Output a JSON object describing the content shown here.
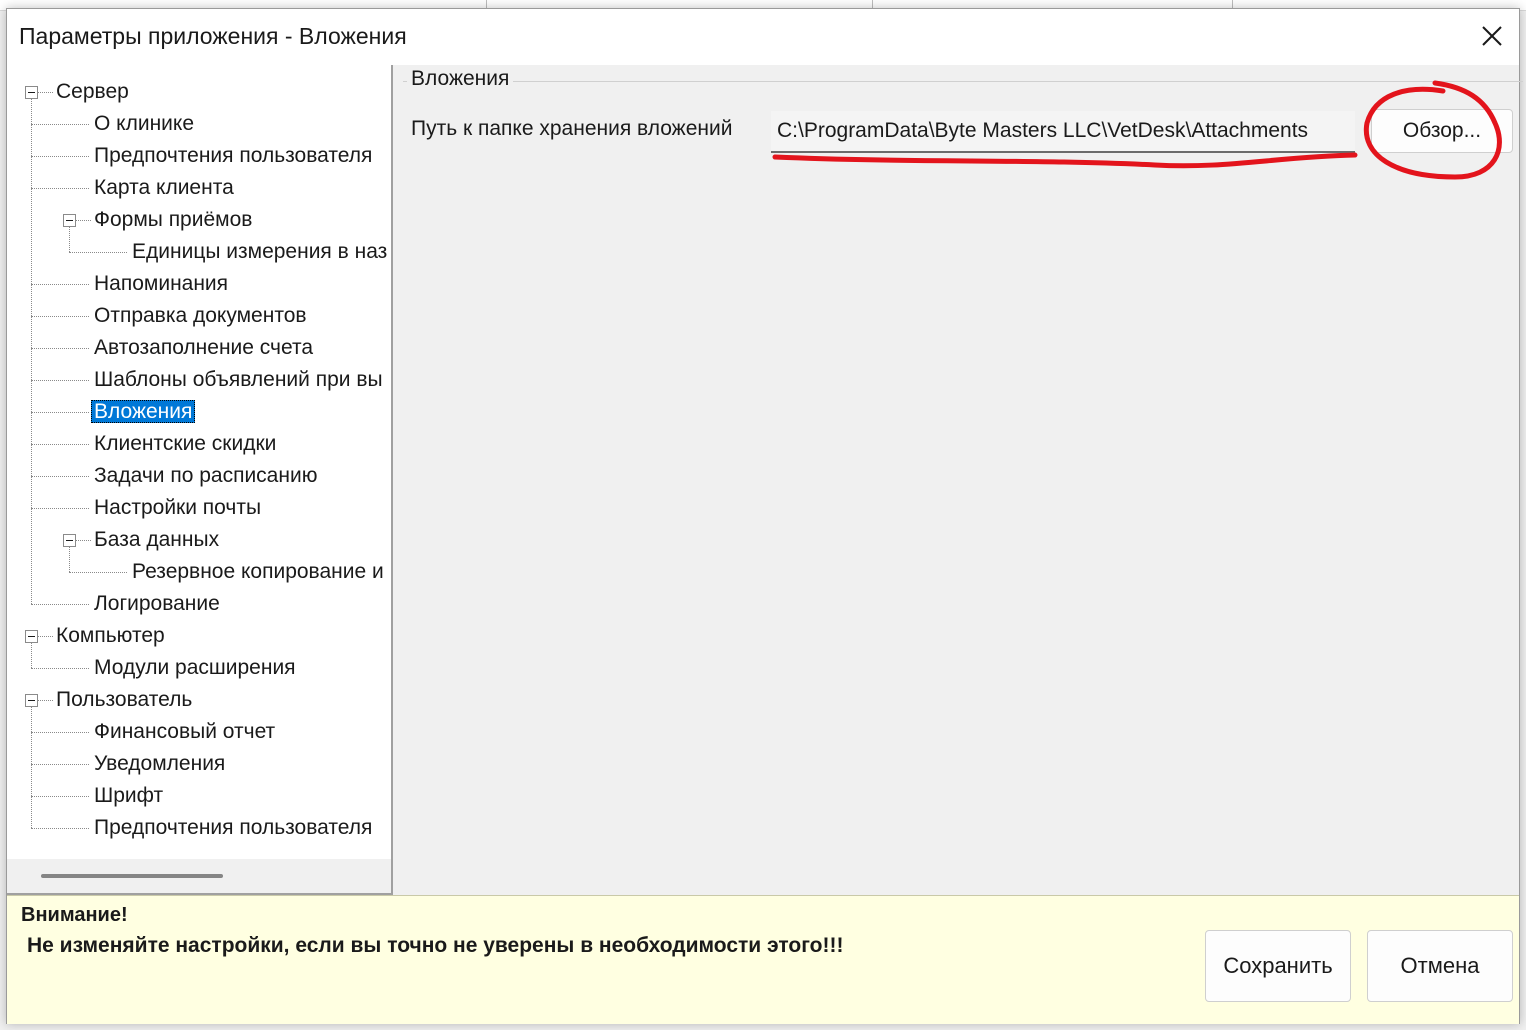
{
  "window": {
    "title": "Параметры приложения - Вложения"
  },
  "tree": {
    "items": [
      {
        "label": "Сервер",
        "level": 0,
        "expanded": true
      },
      {
        "label": "О клинике",
        "level": 1
      },
      {
        "label": "Предпочтения пользователя",
        "level": 1
      },
      {
        "label": "Карта клиента",
        "level": 1
      },
      {
        "label": "Формы приёмов",
        "level": 1,
        "expanded": true
      },
      {
        "label": "Единицы измерения в наз",
        "level": 2
      },
      {
        "label": "Напоминания",
        "level": 1
      },
      {
        "label": "Отправка документов",
        "level": 1
      },
      {
        "label": "Автозаполнение счета",
        "level": 1
      },
      {
        "label": "Шаблоны объявлений при вы",
        "level": 1
      },
      {
        "label": "Вложения",
        "level": 1,
        "selected": true
      },
      {
        "label": "Клиентские скидки",
        "level": 1
      },
      {
        "label": "Задачи по расписанию",
        "level": 1
      },
      {
        "label": "Настройки почты",
        "level": 1
      },
      {
        "label": "База данных",
        "level": 1,
        "expanded": true
      },
      {
        "label": "Резервное копирование и",
        "level": 2
      },
      {
        "label": "Логирование",
        "level": 1
      },
      {
        "label": "Компьютер",
        "level": 0,
        "expanded": true
      },
      {
        "label": "Модули расширения",
        "level": 1
      },
      {
        "label": "Пользователь",
        "level": 0,
        "expanded": true
      },
      {
        "label": "Финансовый отчет",
        "level": 1
      },
      {
        "label": "Уведомления",
        "level": 1
      },
      {
        "label": "Шрифт",
        "level": 1
      },
      {
        "label": "Предпочтения пользователя",
        "level": 1
      }
    ]
  },
  "attachments": {
    "group_title": "Вложения",
    "path_label": "Путь к папке хранения вложений",
    "path_value": "C:\\ProgramData\\Byte Masters LLC\\VetDesk\\Attachments",
    "browse_label": "Обзор..."
  },
  "warning": {
    "title": "Внимание!",
    "text": "Не изменяйте настройки, если вы точно не уверены в необходимости этого!!!"
  },
  "buttons": {
    "save_label": "Сохранить",
    "cancel_label": "Отмена"
  },
  "colors": {
    "selection": "#0078d7",
    "warning_background": "#ffffe1",
    "annotation_red": "#e3141c"
  }
}
